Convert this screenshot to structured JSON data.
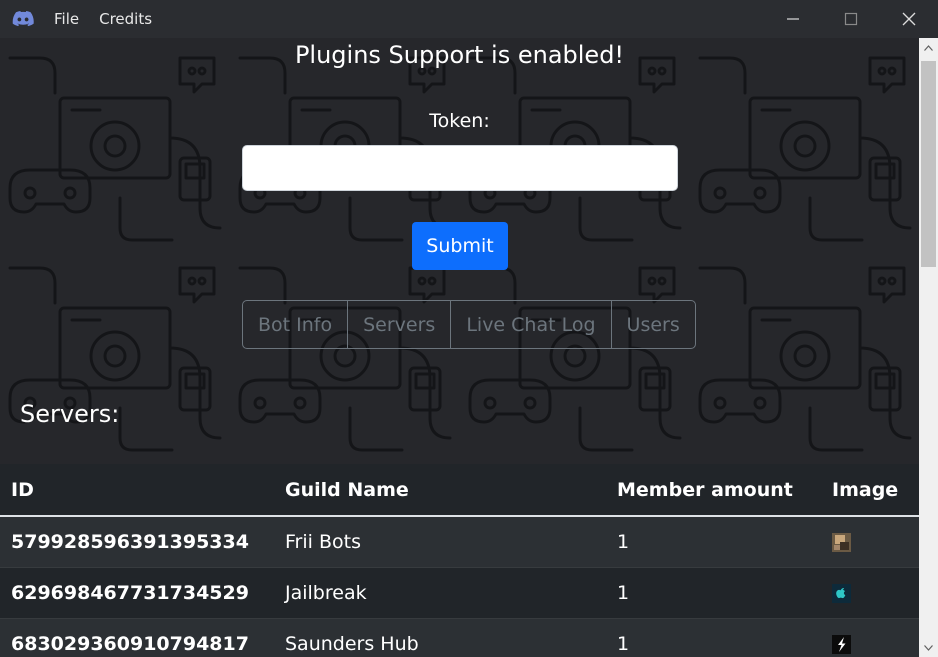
{
  "window": {
    "menu": [
      {
        "label": "File"
      },
      {
        "label": "Credits"
      }
    ]
  },
  "main": {
    "status_title": "Plugins Support is enabled!",
    "token_label": "Token:",
    "token_value": "",
    "submit_label": "Submit",
    "tabs": [
      {
        "label": "Bot Info"
      },
      {
        "label": "Servers"
      },
      {
        "label": "Live Chat Log"
      },
      {
        "label": "Users"
      }
    ],
    "section_heading": "Servers:"
  },
  "table": {
    "headers": {
      "id": "ID",
      "guild_name": "Guild Name",
      "member_amount": "Member amount",
      "image": "Image"
    },
    "rows": [
      {
        "id": "579928596391395334",
        "guild_name": "Frii Bots",
        "member_amount": "1",
        "image_icon": "frii-bots-guild-icon"
      },
      {
        "id": "629698467731734529",
        "guild_name": "Jailbreak",
        "member_amount": "1",
        "image_icon": "jailbreak-guild-icon"
      },
      {
        "id": "683029360910794817",
        "guild_name": "Saunders Hub",
        "member_amount": "1",
        "image_icon": "saunders-hub-guild-icon"
      }
    ]
  },
  "colors": {
    "submit": "#0d6efd",
    "titlebar": "#2b2d31",
    "discord_logo": "#7289da"
  }
}
